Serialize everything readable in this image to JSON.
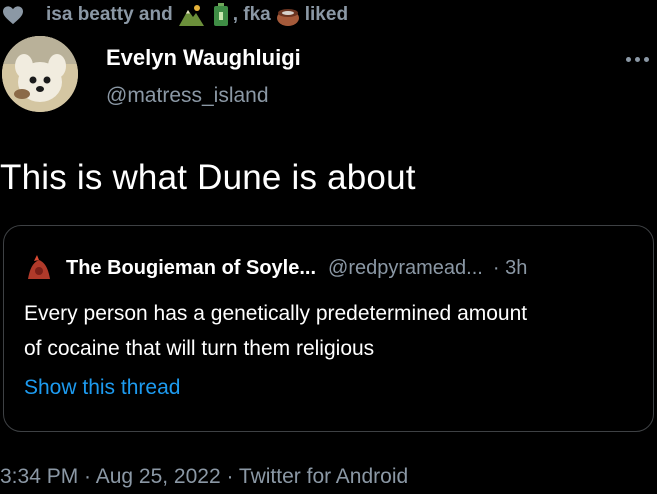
{
  "liked_banner": {
    "user1": "isa beatty and",
    "user2_suffix": ", fka",
    "action": "liked",
    "icons": [
      "heart-icon",
      "mountain-emoji-icon",
      "battery-emoji-icon",
      "cup-emoji-icon"
    ]
  },
  "tweet": {
    "display_name": "Evelyn Waughluigi",
    "handle": "@matress_island",
    "text": "This is what Dune is about"
  },
  "quote": {
    "display_name": "The Bougieman of Soyle...",
    "handle": "@redpyramead...",
    "time": "· 3h",
    "body_lines": [
      "Every person has a genetically predetermined amount",
      "of cocaine that will turn them religious"
    ],
    "show_thread": "Show this thread"
  },
  "meta": {
    "timestamp": "3:34 PM · Aug 25, 2022 · Twitter for Android"
  },
  "colors": {
    "background": "#000000",
    "primary_text": "#ffffff",
    "secondary_text": "#8b98a5",
    "link": "#1d9bf0",
    "border": "#3e4144"
  }
}
